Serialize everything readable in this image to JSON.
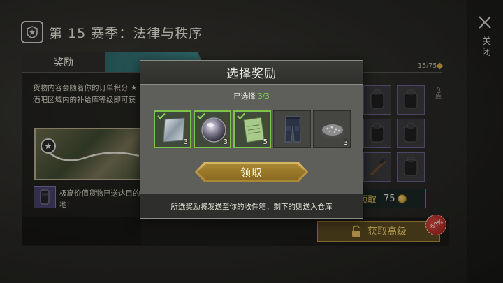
{
  "header": {
    "season_title": "第 15 赛季：法律与秩序",
    "close_label": "关闭",
    "emblem_icon": "season-badge-icon"
  },
  "tabs": [
    {
      "label": "奖励"
    },
    {
      "label": ""
    }
  ],
  "left_panel": {
    "description": "货物内容会随着你的订单积分 ★ 酒吧区域内的补给库等级即可获",
    "cargo_text": "极高价值货物已送达目的地!"
  },
  "progress": {
    "label": "15/75",
    "current": 15,
    "total": 75
  },
  "side_label": "仓库",
  "partial_claim": {
    "label": "领取",
    "cost": "75"
  },
  "premium": {
    "label": "获取高级",
    "discount": "-60%"
  },
  "modal": {
    "title": "选择奖励",
    "selected_prefix": "已选择",
    "selected_count": "3/3",
    "items": [
      {
        "name": "metal-plate",
        "qty": "3",
        "selected": true
      },
      {
        "name": "glass-lens",
        "qty": "3",
        "selected": true
      },
      {
        "name": "notebook",
        "qty": "5",
        "selected": true
      },
      {
        "name": "tactical-pants",
        "qty": "",
        "selected": false
      },
      {
        "name": "gravel-pile",
        "qty": "3",
        "selected": false
      }
    ],
    "claim_label": "领取",
    "footer_text": "所选奖励将发送至你的收件箱，剩下的则送入仓库"
  },
  "colors": {
    "accent_teal": "#3f8a8c",
    "selected_green": "#7dc24a",
    "gold": "#d6a640",
    "badge_red": "#c7382f"
  }
}
